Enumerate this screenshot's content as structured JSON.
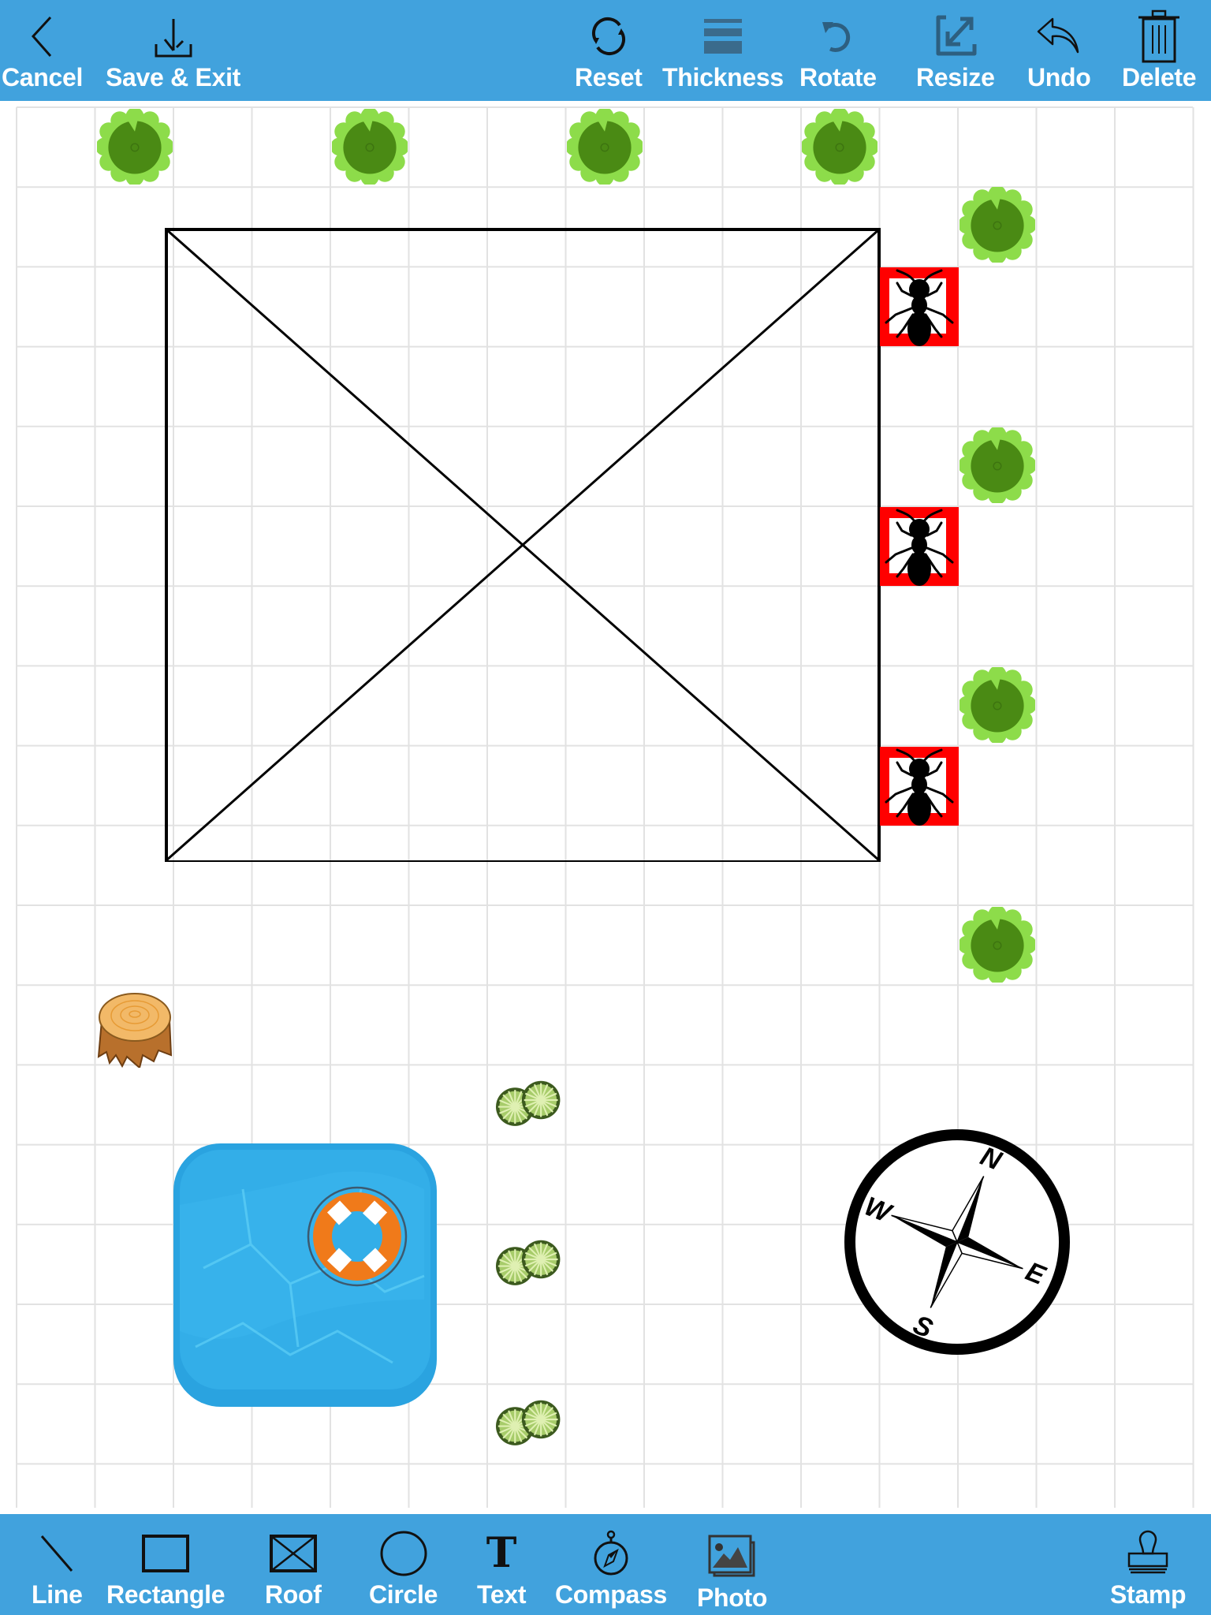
{
  "top_toolbar": {
    "left": [
      {
        "id": "cancel",
        "label": "Cancel",
        "icon": "chevron-left-icon"
      },
      {
        "id": "save-exit",
        "label": "Save & Exit",
        "icon": "download-icon"
      }
    ],
    "right": [
      {
        "id": "reset",
        "label": "Reset",
        "icon": "refresh-icon"
      },
      {
        "id": "thickness",
        "label": "Thickness",
        "icon": "thickness-icon"
      },
      {
        "id": "rotate",
        "label": "Rotate",
        "icon": "rotate-icon"
      },
      {
        "id": "resize",
        "label": "Resize",
        "icon": "resize-icon"
      },
      {
        "id": "undo",
        "label": "Undo",
        "icon": "undo-icon"
      },
      {
        "id": "delete",
        "label": "Delete",
        "icon": "trash-icon"
      }
    ]
  },
  "bottom_toolbar": {
    "tools": [
      {
        "id": "line",
        "label": "Line",
        "icon": "line-icon"
      },
      {
        "id": "rectangle",
        "label": "Rectangle",
        "icon": "rectangle-icon"
      },
      {
        "id": "roof",
        "label": "Roof",
        "icon": "roof-icon"
      },
      {
        "id": "circle",
        "label": "Circle",
        "icon": "circle-icon"
      },
      {
        "id": "text",
        "label": "Text",
        "icon": "text-icon"
      },
      {
        "id": "compass",
        "label": "Compass",
        "icon": "compass-icon"
      },
      {
        "id": "photo",
        "label": "Photo",
        "icon": "photo-icon"
      },
      {
        "id": "stamp",
        "label": "Stamp",
        "icon": "stamp-icon"
      }
    ]
  },
  "canvas": {
    "compass_labels": {
      "n": "N",
      "e": "E",
      "s": "S",
      "w": "W"
    },
    "stamps": {
      "trees": 8,
      "termite_markers": 3,
      "shrubs": 3,
      "stumps": 1,
      "pools": 1,
      "compass": 1
    },
    "shapes": [
      "roof"
    ]
  },
  "colors": {
    "toolbar": "#41a2dd",
    "toolbar_label": "#ffffff",
    "grid_line": "#e2e2e2",
    "tree_dark": "#4a8a14",
    "tree_light": "#8ddc4a",
    "termite_box": "#ff0000",
    "pool": "#2aa3e0",
    "lifebuoy": "#f07a1a"
  }
}
